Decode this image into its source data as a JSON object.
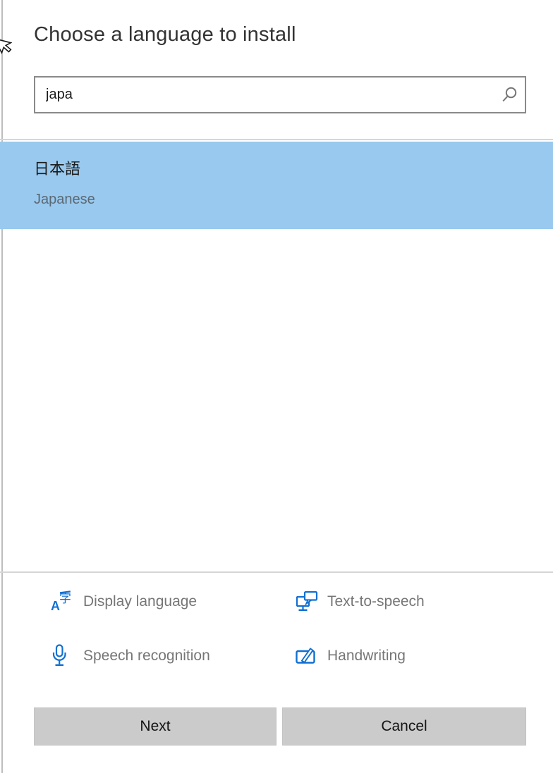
{
  "dialog": {
    "title": "Choose a language to install",
    "search": {
      "value": "japa"
    },
    "results": [
      {
        "native_name": "日本語",
        "english_name": "Japanese",
        "selected": true
      }
    ],
    "legend": [
      {
        "label": "Display language",
        "icon": "translate-icon"
      },
      {
        "label": "Text-to-speech",
        "icon": "text-to-speech-icon"
      },
      {
        "label": "Speech recognition",
        "icon": "microphone-icon"
      },
      {
        "label": "Handwriting",
        "icon": "handwriting-icon"
      }
    ],
    "buttons": {
      "next": "Next",
      "cancel": "Cancel"
    },
    "colors": {
      "selection_background": "#99C9EE",
      "icon_accent": "#1070D2",
      "button_background": "#CBCBCB",
      "legend_text": "#767676"
    }
  }
}
